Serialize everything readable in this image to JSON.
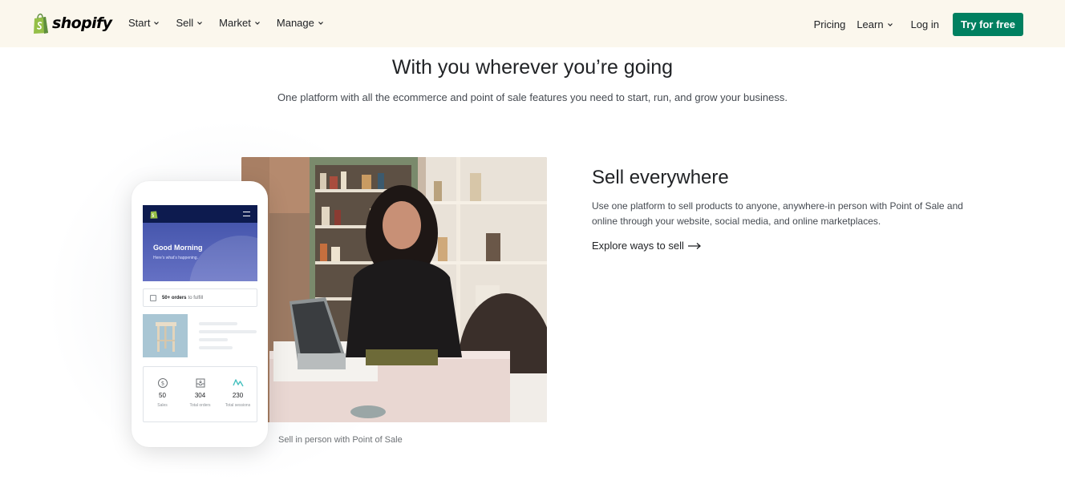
{
  "brand": {
    "name": "shopify",
    "accent": "#008060",
    "header_bg": "#fbf7ed"
  },
  "nav": {
    "left": [
      {
        "label": "Start",
        "icon": "chevron-down-icon"
      },
      {
        "label": "Sell",
        "icon": "chevron-down-icon"
      },
      {
        "label": "Market",
        "icon": "chevron-down-icon"
      },
      {
        "label": "Manage",
        "icon": "chevron-down-icon"
      }
    ],
    "pricing": "Pricing",
    "learn": "Learn",
    "login": "Log in",
    "cta": "Try for free"
  },
  "hero": {
    "title": "With you wherever you’re going",
    "subtitle": "One platform with all the ecommerce and point of sale features you need to start, run, and grow your business."
  },
  "phone": {
    "greeting": "Good Morning",
    "greeting_sub": "Here’s what’s happening.",
    "orders_count": "50+ orders",
    "orders_text": "to fulfill",
    "stats": [
      {
        "icon": "dollar-icon",
        "value": "50",
        "label": "Sales"
      },
      {
        "icon": "orders-icon",
        "value": "304",
        "label": "Total orders"
      },
      {
        "icon": "sessions-graph-icon",
        "value": "230",
        "label": "Total sessions"
      }
    ]
  },
  "photo": {
    "caption": "Sell in person with Point of Sale"
  },
  "section": {
    "title": "Sell everywhere",
    "body": "Use one platform to sell products to anyone, anywhere-in person with Point of Sale and online through your website, social media, and online marketplaces.",
    "link": "Explore ways to sell"
  }
}
